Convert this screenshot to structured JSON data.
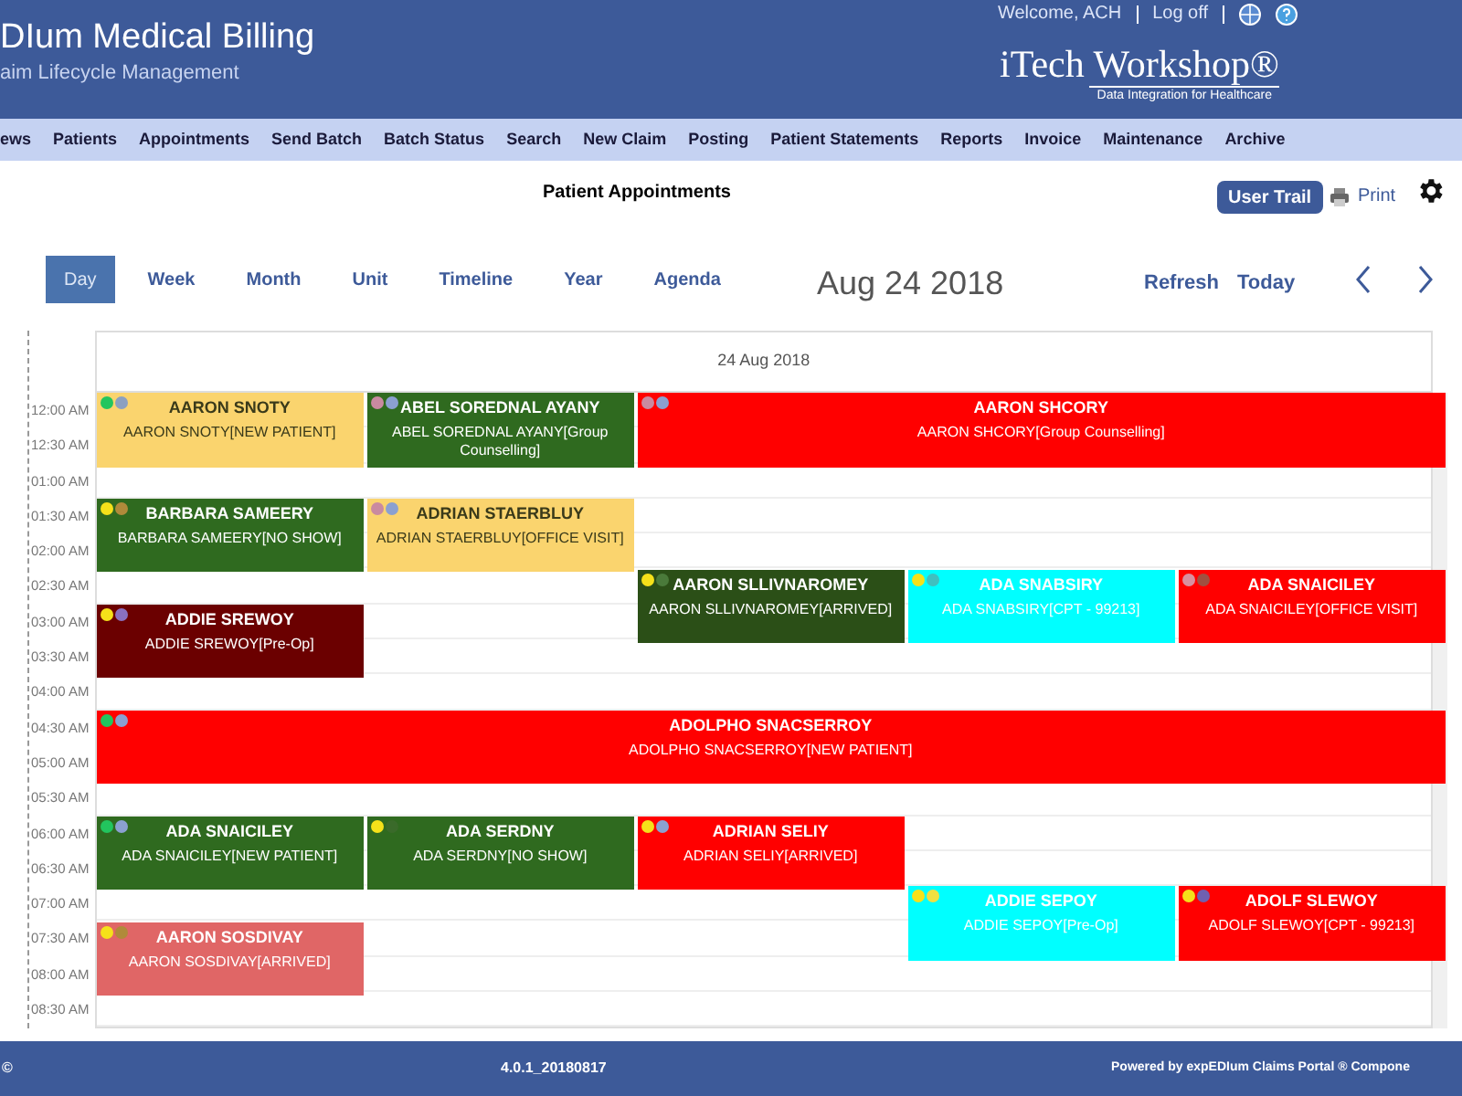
{
  "header": {
    "title": "DIum Medical Billing",
    "subtitle": "aim Lifecycle Management",
    "welcome": "Welcome, ACH",
    "logoff": "Log off",
    "logo": "iTech Workshop®",
    "tagline": "Data Integration for Healthcare"
  },
  "nav": [
    "ews",
    "Patients",
    "Appointments",
    "Send Batch",
    "Batch Status",
    "Search",
    "New Claim",
    "Posting",
    "Patient Statements",
    "Reports",
    "Invoice",
    "Maintenance",
    "Archive"
  ],
  "page_title": "Patient Appointments",
  "actions": {
    "user_trail": "User Trail",
    "print": "Print"
  },
  "views": [
    {
      "label": "Day",
      "selected": true
    },
    {
      "label": "Week",
      "selected": false
    },
    {
      "label": "Month",
      "selected": false
    },
    {
      "label": "Unit",
      "selected": false
    },
    {
      "label": "Timeline",
      "selected": false
    },
    {
      "label": "Year",
      "selected": false
    },
    {
      "label": "Agenda",
      "selected": false
    }
  ],
  "current_date": "Aug 24 2018",
  "controls": {
    "refresh": "Refresh",
    "today": "Today"
  },
  "calendar": {
    "day_header": "24 Aug 2018",
    "times": [
      "12:00 AM",
      "12:30 AM",
      "01:00 AM",
      "01:30 AM",
      "02:00 AM",
      "02:30 AM",
      "03:00 AM",
      "03:30 AM",
      "04:00 AM",
      "04:30 AM",
      "05:00 AM",
      "05:30 AM",
      "06:00 AM",
      "06:30 AM",
      "07:00 AM",
      "07:30 AM",
      "08:00 AM",
      "08:30 AM"
    ],
    "events": [
      {
        "name": "AARON SNOTY",
        "detail": "AARON SNOTY[NEW PATIENT]",
        "color": "#fad46e",
        "dots": [
          {
            "color": "#22c55e"
          },
          {
            "color": "#8ba0c0"
          }
        ]
      },
      {
        "name": "ABEL SOREDNAL AYANY",
        "detail": "ABEL SOREDNAL AYANY[Group Counselling]",
        "color": "#2f6a1f",
        "dots": [
          {
            "color": "#c98aa0"
          },
          {
            "color": "#8ba0d0"
          }
        ]
      },
      {
        "name": "AARON SHCORY",
        "detail": "AARON SHCORY[Group Counselling]",
        "color": "#ff0000",
        "dots": [
          {
            "color": "#c98aa0"
          },
          {
            "color": "#8ba0d0"
          }
        ]
      },
      {
        "name": "BARBARA SAMEERY",
        "detail": "BARBARA SAMEERY[NO SHOW]",
        "color": "#2f6a1f",
        "dots": [
          {
            "color": "#f5e11a"
          },
          {
            "color": "#b08a3a"
          }
        ]
      },
      {
        "name": "ADRIAN STAERBLUY",
        "detail": "ADRIAN STAERBLUY[OFFICE VISIT]",
        "color": "#fad46e",
        "dots": [
          {
            "color": "#c98aa0"
          },
          {
            "color": "#8ba0d0"
          }
        ]
      },
      {
        "name": "AARON SLLIVNAROMEY",
        "detail": "AARON SLLIVNAROMEY[ARRIVED]",
        "color": "#2b4f17",
        "dots": [
          {
            "color": "#f5e11a"
          },
          {
            "color": "#4a7a3a"
          }
        ]
      },
      {
        "name": "ADA SNABSIRY",
        "detail": "ADA SNABSIRY[CPT - 99213]",
        "color": "#00ffff",
        "dots": [
          {
            "color": "#f5e11a"
          },
          {
            "color": "#40c0c0"
          }
        ]
      },
      {
        "name": "ADA SNAICILEY",
        "detail": "ADA SNAICILEY[OFFICE VISIT]",
        "color": "#ff0000",
        "dots": [
          {
            "color": "#d890a0"
          },
          {
            "color": "#a05040"
          }
        ]
      },
      {
        "name": "ADDIE SREWOY",
        "detail": "ADDIE SREWOY[Pre-Op]",
        "color": "#6b0000",
        "dots": [
          {
            "color": "#f5e11a"
          },
          {
            "color": "#8a70c0"
          }
        ]
      },
      {
        "name": "ADOLPHO SNACSERROY",
        "detail": "ADOLPHO SNACSERROY[NEW PATIENT]",
        "color": "#ff0000",
        "dots": [
          {
            "color": "#22c55e"
          },
          {
            "color": "#8ba0d0"
          }
        ]
      },
      {
        "name": "ADA SNAICILEY",
        "detail": "ADA SNAICILEY[NEW PATIENT]",
        "color": "#2f6a1f",
        "dots": [
          {
            "color": "#22c55e"
          },
          {
            "color": "#8ba0d0"
          }
        ]
      },
      {
        "name": "ADA SERDNY",
        "detail": "ADA SERDNY[NO SHOW]",
        "color": "#2f6a1f",
        "dots": [
          {
            "color": "#f5e11a"
          },
          {
            "color": "#3a6a2a"
          }
        ]
      },
      {
        "name": "ADRIAN SELIY",
        "detail": "ADRIAN SELIY[ARRIVED]",
        "color": "#ff0000",
        "dots": [
          {
            "color": "#f5e11a"
          },
          {
            "color": "#8ba0d0"
          }
        ]
      },
      {
        "name": "ADDIE SEPOY",
        "detail": "ADDIE SEPOY[Pre-Op]",
        "color": "#00ffff",
        "dots": [
          {
            "color": "#f5e11a"
          },
          {
            "color": "#f0e040"
          }
        ]
      },
      {
        "name": "ADOLF SLEWOY",
        "detail": "ADOLF SLEWOY[CPT - 99213]",
        "color": "#ff0000",
        "dots": [
          {
            "color": "#f5e11a"
          },
          {
            "color": "#7060b0"
          }
        ]
      },
      {
        "name": "AARON SOSDIVAY",
        "detail": "AARON SOSDIVAY[ARRIVED]",
        "color": "#e06666",
        "dots": [
          {
            "color": "#f5e11a"
          },
          {
            "color": "#b08a3a"
          }
        ]
      }
    ]
  },
  "footer": {
    "left": "©",
    "version": "4.0.1_20180817",
    "powered": "Powered by expEDIum Claims Portal ® Compone"
  }
}
